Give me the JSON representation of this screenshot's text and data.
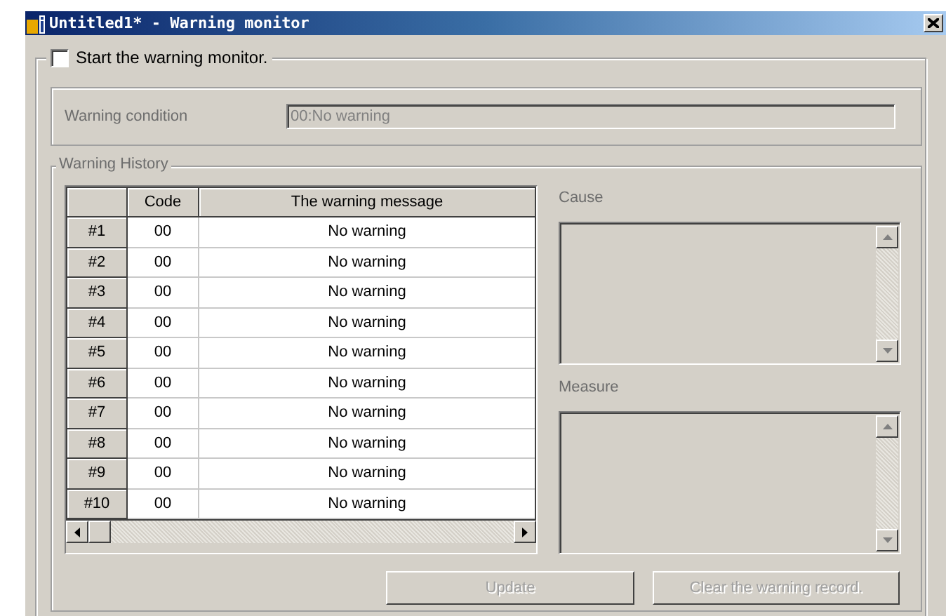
{
  "window": {
    "title": "Untitled1* - Warning monitor"
  },
  "monitor": {
    "label": "Start the warning monitor.",
    "checked": false
  },
  "condition": {
    "label": "Warning condition",
    "value": "00:No warning"
  },
  "history": {
    "title": "Warning History",
    "columns": [
      "Code",
      "The warning message"
    ],
    "rows": [
      {
        "header": "#1",
        "code": "00",
        "message": "No warning"
      },
      {
        "header": "#2",
        "code": "00",
        "message": "No warning"
      },
      {
        "header": "#3",
        "code": "00",
        "message": "No warning"
      },
      {
        "header": "#4",
        "code": "00",
        "message": "No warning"
      },
      {
        "header": "#5",
        "code": "00",
        "message": "No warning"
      },
      {
        "header": "#6",
        "code": "00",
        "message": "No warning"
      },
      {
        "header": "#7",
        "code": "00",
        "message": "No warning"
      },
      {
        "header": "#8",
        "code": "00",
        "message": "No warning"
      },
      {
        "header": "#9",
        "code": "00",
        "message": "No warning"
      },
      {
        "header": "#10",
        "code": "00",
        "message": "No warning"
      }
    ],
    "cause_label": "Cause",
    "measure_label": "Measure"
  },
  "buttons": [
    {
      "label": "Update",
      "disabled": true
    },
    {
      "label": "Clear the warning record.",
      "disabled": true
    }
  ]
}
